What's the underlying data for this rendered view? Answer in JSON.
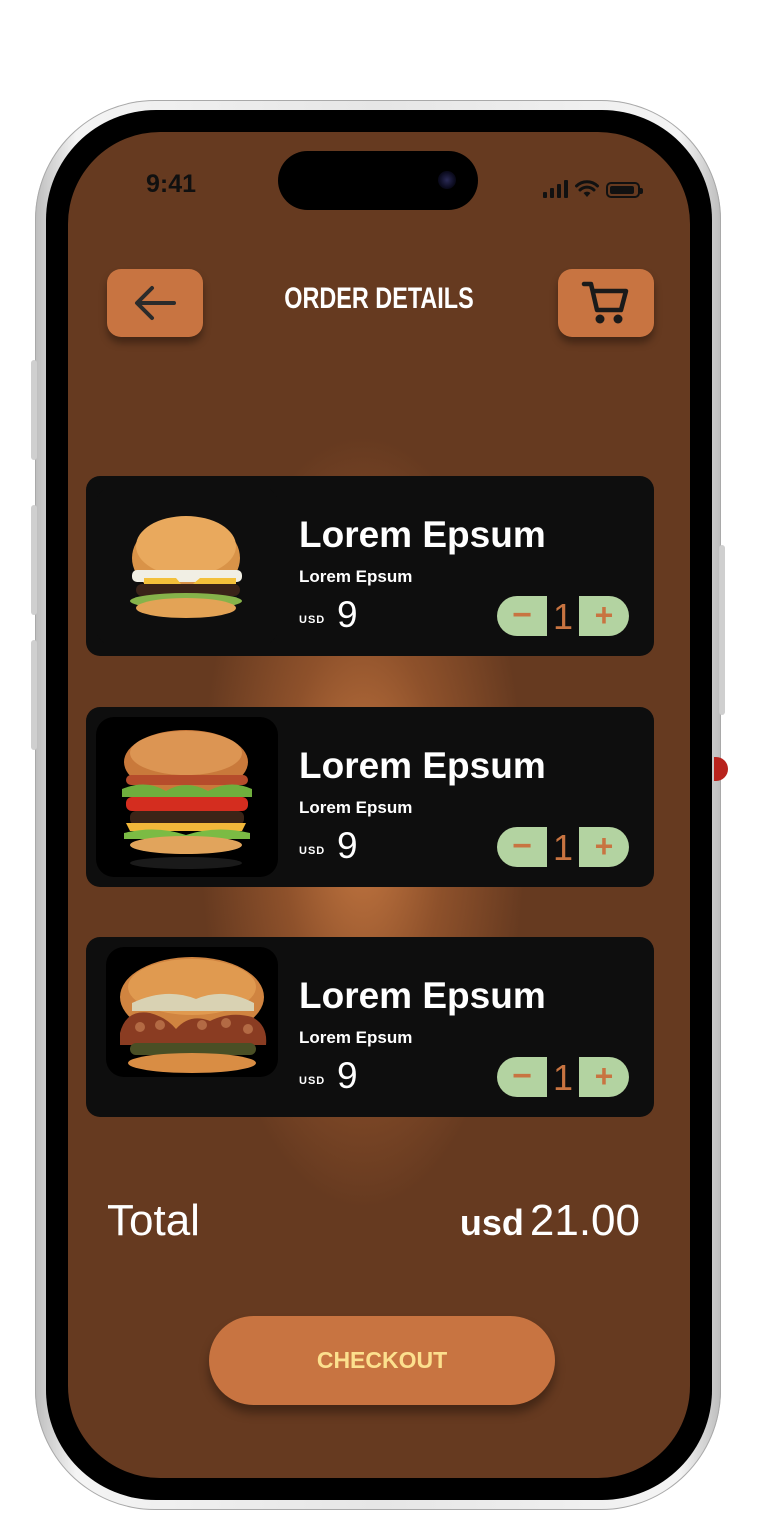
{
  "status_bar": {
    "time": "9:41"
  },
  "header": {
    "title": "ORDER DETAILS",
    "back_icon": "arrow-left-icon",
    "cart_icon": "cart-icon"
  },
  "colors": {
    "background": "#663a20",
    "accent": "#c87441",
    "card": "#0e0e0e",
    "stepper": "#b3d3a1",
    "checkout_text": "#fce08e"
  },
  "items": [
    {
      "name": "Lorem Epsum",
      "description": "Lorem Epsum",
      "currency": "USD",
      "price": "9",
      "quantity": "1",
      "minus": "−",
      "plus": "+",
      "image": "burger-cheese-image"
    },
    {
      "name": "Lorem Epsum",
      "description": "Lorem Epsum",
      "currency": "USD",
      "price": "9",
      "quantity": "1",
      "minus": "−",
      "plus": "+",
      "image": "burger-bacon-image"
    },
    {
      "name": "Lorem Epsum",
      "description": "Lorem Epsum",
      "currency": "USD",
      "price": "9",
      "quantity": "1",
      "minus": "−",
      "plus": "+",
      "image": "burger-octopus-image"
    }
  ],
  "total": {
    "label": "Total",
    "currency": "usd",
    "amount": "21.00"
  },
  "checkout": {
    "label": "CHECKOUT"
  }
}
